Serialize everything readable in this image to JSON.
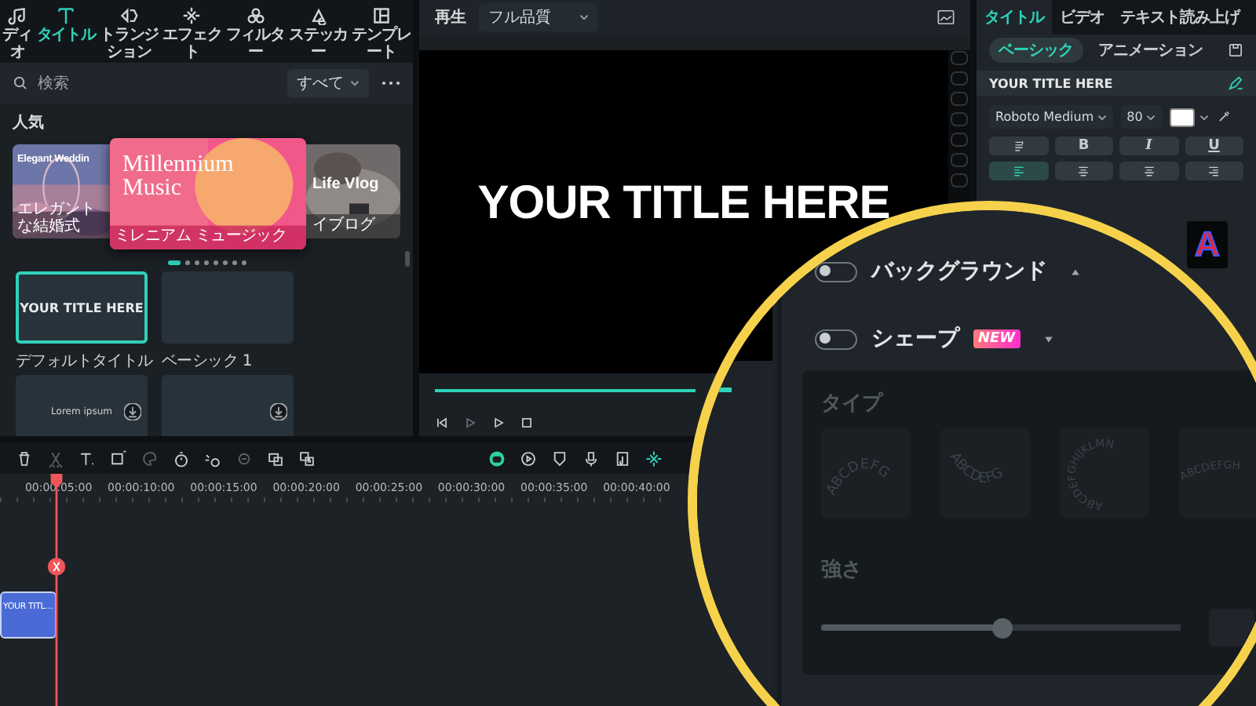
{
  "library": {
    "tabs": [
      {
        "label": "ディオ",
        "selected": false
      },
      {
        "label": "タイトル",
        "selected": true
      },
      {
        "label": "トランジション",
        "selected": false
      },
      {
        "label": "エフェクト",
        "selected": false
      },
      {
        "label": "フィルター",
        "selected": false
      },
      {
        "label": "ステッカー",
        "selected": false
      },
      {
        "label": "テンプレート",
        "selected": false
      }
    ],
    "search": {
      "placeholder": "検索",
      "filter": "すべて"
    },
    "section_title": "人気",
    "featured": [
      {
        "title": "Elegant Weddin",
        "caption": "エレガントな結婚式"
      },
      {
        "title": "Millennium Music",
        "caption": "ミレニアム ミュージック"
      },
      {
        "title": "Life Vlog",
        "caption": "イブログ"
      }
    ],
    "dots": [
      {
        "selected": true
      },
      {
        "selected": false
      },
      {
        "selected": false
      },
      {
        "selected": false
      },
      {
        "selected": false
      },
      {
        "selected": false
      },
      {
        "selected": false
      },
      {
        "selected": false
      }
    ],
    "templates": [
      {
        "preview": "YOUR TITLE HERE",
        "caption": "デフォルトタイトル",
        "selected": true,
        "download": false
      },
      {
        "caption": "ベーシック 1",
        "selected": false,
        "download": false
      },
      {
        "preview": "Lorem ipsum",
        "selected": false,
        "download": true
      },
      {
        "selected": false,
        "download": true
      }
    ]
  },
  "player": {
    "label": "再生",
    "quality": "フル品質",
    "title": "YOUR TITLE HERE",
    "progress": {
      "level": 1
    }
  },
  "inspector": {
    "tabs": [
      {
        "label": "タイトル",
        "selected": true
      },
      {
        "label": "ビデオ",
        "selected": false
      },
      {
        "label": "テキスト読み上げ",
        "selected": false
      }
    ],
    "subtabs": [
      {
        "label": "ベーシック",
        "selected": true
      },
      {
        "label": "アニメーション",
        "selected": false
      }
    ],
    "text": "YOUR TITLE HERE",
    "font": "Roboto Medium",
    "size": "80",
    "color": "#ffffff",
    "format_buttons": [
      {
        "kind": "icon"
      },
      {
        "kind": "text",
        "label": "B"
      },
      {
        "kind": "text",
        "label": "I"
      },
      {
        "kind": "text",
        "label": "U"
      }
    ],
    "align_buttons": [
      {
        "selected": true
      },
      {
        "selected": false
      },
      {
        "selected": false
      },
      {
        "selected": false
      }
    ],
    "preset": "A"
  },
  "timeline": {
    "times": [
      "00:00:05:00",
      "00:00:10:00",
      "00:00:15:00",
      "00:00:20:00",
      "00:00:25:00",
      "00:00:30:00",
      "00:00:35:00",
      "00:00:40:00"
    ],
    "clip": "YOUR TITL…"
  },
  "magnifier": {
    "toggles": [
      {
        "label": "バックグラウンド",
        "on": false,
        "expanded": true
      },
      {
        "label": "シェープ",
        "on": false,
        "expanded": false,
        "badge": "NEW"
      }
    ],
    "type_label": "タイプ",
    "shapes": [
      {
        "kind": "arch",
        "text": "ABCDEFG"
      },
      {
        "kind": "smile",
        "text": "ABCDEFG"
      },
      {
        "kind": "circle",
        "text": "ABCDEFGHIJKLMN"
      },
      {
        "kind": "flat",
        "text": "ABCDEFGH"
      }
    ],
    "strength_label": "強さ",
    "strength": {
      "level": 0.5
    }
  }
}
